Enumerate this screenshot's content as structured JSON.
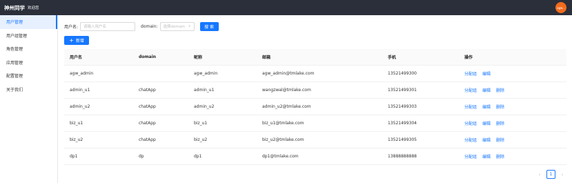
{
  "header": {
    "brand": "神州同学",
    "welcome": "欢迎您",
    "avatar_text": "agw..."
  },
  "sidebar": {
    "items": [
      {
        "label": "用户管理",
        "active": true
      },
      {
        "label": "用户组管理"
      },
      {
        "label": "角色管理"
      },
      {
        "label": "应用管理"
      },
      {
        "label": "配置管理"
      },
      {
        "label": "关于我们"
      }
    ]
  },
  "search": {
    "username_label": "用户名:",
    "username_placeholder": "请输入用户名",
    "domain_label": "domain:",
    "domain_placeholder": "选择domain",
    "search_button": "搜 索"
  },
  "toolbar": {
    "add_button": "新增"
  },
  "table": {
    "columns": [
      "用户名",
      "domain",
      "昵称",
      "邮箱",
      "手机",
      "操作"
    ],
    "rows": [
      {
        "username": "agw_admin",
        "domain": "",
        "nickname": "agw_admin",
        "email": "agw_admin@tmlake.com",
        "phone": "13521499300",
        "actions": [
          "分配组",
          "编辑"
        ]
      },
      {
        "username": "admin_u1",
        "domain": "chatApp",
        "nickname": "admin_u1",
        "email": "wangzwal@tmlake.com",
        "phone": "13521499301",
        "actions": [
          "分配组",
          "编辑",
          "删除"
        ]
      },
      {
        "username": "admin_u2",
        "domain": "chatApp",
        "nickname": "admin_u2",
        "email": "admin_u2@tmlake.com",
        "phone": "13521499303",
        "actions": [
          "分配组",
          "编辑",
          "删除"
        ]
      },
      {
        "username": "biz_u1",
        "domain": "chatApp",
        "nickname": "biz_u1",
        "email": "biz_u1@tmlake.com",
        "phone": "13521499304",
        "actions": [
          "分配组",
          "编辑",
          "删除"
        ]
      },
      {
        "username": "biz_u2",
        "domain": "chatApp",
        "nickname": "biz_u2",
        "email": "biz_u2@tmlake.com",
        "phone": "13521499305",
        "actions": [
          "分配组",
          "编辑",
          "删除"
        ]
      },
      {
        "username": "dp1",
        "domain": "dp",
        "nickname": "dp1",
        "email": "dp1@tmlake.com",
        "phone": "13888888888",
        "actions": [
          "分配组",
          "编辑",
          "删除"
        ]
      }
    ]
  },
  "pagination": {
    "current_page": "1"
  },
  "colors": {
    "primary": "#1677ff",
    "topbar": "#2b2f3a",
    "avatar": "#f26b1d"
  }
}
